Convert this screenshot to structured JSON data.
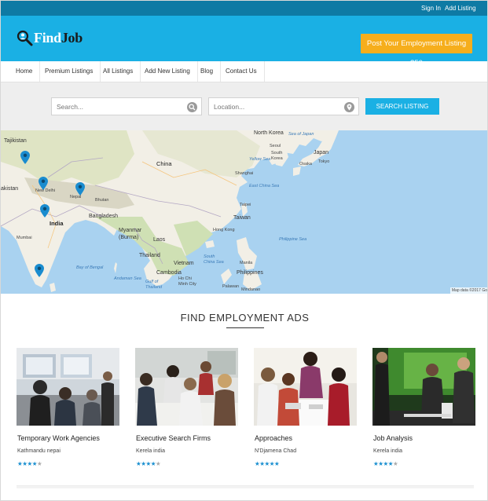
{
  "topbar": {
    "sign_in": "Sign In",
    "add_listing": "Add Listing"
  },
  "header": {
    "logo_part1": "Find",
    "logo_part2": "Job",
    "post_button": "Post Your Employment Listing $50"
  },
  "nav": {
    "items": [
      {
        "label": "Home"
      },
      {
        "label": "Premium Listings"
      },
      {
        "label": "All Listings"
      },
      {
        "label": "Add New Listing"
      },
      {
        "label": "Blog"
      },
      {
        "label": "Contact Us"
      }
    ]
  },
  "search": {
    "keyword_placeholder": "Search...",
    "location_placeholder": "Location...",
    "button": "SEARCH LISTING"
  },
  "map": {
    "labels": {
      "tajikistan": "Tajikistan",
      "akistan": "akistan",
      "new_delhi": "New Delhi",
      "nepal": "Nepal",
      "bhutan": "Bhutan",
      "bangladesh": "Bangladesh",
      "india": "India",
      "mumbai": "Mumbai",
      "bay_of_bengal": "Bay of Bengal",
      "andaman_sea": "Andaman Sea",
      "myanmar": "Myanmar\n(Burma)",
      "laos": "Laos",
      "thailand": "Thailand",
      "vietnam": "Vietnam",
      "cambodia": "Cambodia",
      "ho_chi_minh": "Ho Chi\nMinh City",
      "gulf_thailand": "Gulf of\nThailand",
      "china": "China",
      "north_korea": "North Korea",
      "seoul": "Seoul",
      "south_korea": "South\nKorea",
      "japan": "Japan",
      "tokyo": "Tokyo",
      "osaka": "Osaka",
      "sea_of_japan": "Sea of Japan",
      "yellow_sea": "Yellow Sea",
      "east_china_sea": "East China Sea",
      "shanghai": "Shanghai",
      "taipei": "Taipei",
      "taiwan": "Taiwan",
      "hong_kong": "Hong Kong",
      "south_china_sea": "South\nChina Sea",
      "philippine_sea": "Philippine Sea",
      "philippines": "Philippines",
      "manila": "Manila",
      "palawan": "Palawan",
      "mindanao": "Mindanao"
    },
    "attribution": "Map data ©2017 Go"
  },
  "section": {
    "title": "FIND EMPLOYMENT ADS"
  },
  "listings": [
    {
      "title": "Temporary Work Agencies",
      "location": "Kathmandu nepai",
      "rating": 4
    },
    {
      "title": "Executive Search Firms",
      "location": "Kerela india",
      "rating": 4
    },
    {
      "title": "Approaches",
      "location": "N'Djamena Chad",
      "rating": 5
    },
    {
      "title": "Job Analysis",
      "location": "Kerela india",
      "rating": 4
    }
  ],
  "colors": {
    "accent": "#1ab0e4",
    "topbar": "#0e7aa4",
    "cta": "#f6ae1c",
    "star": "#1a8fd0"
  },
  "icons": {
    "search": "search-icon",
    "location": "location-pin-icon",
    "map_marker": "map-marker-icon",
    "logo": "magnifier-person-icon"
  }
}
